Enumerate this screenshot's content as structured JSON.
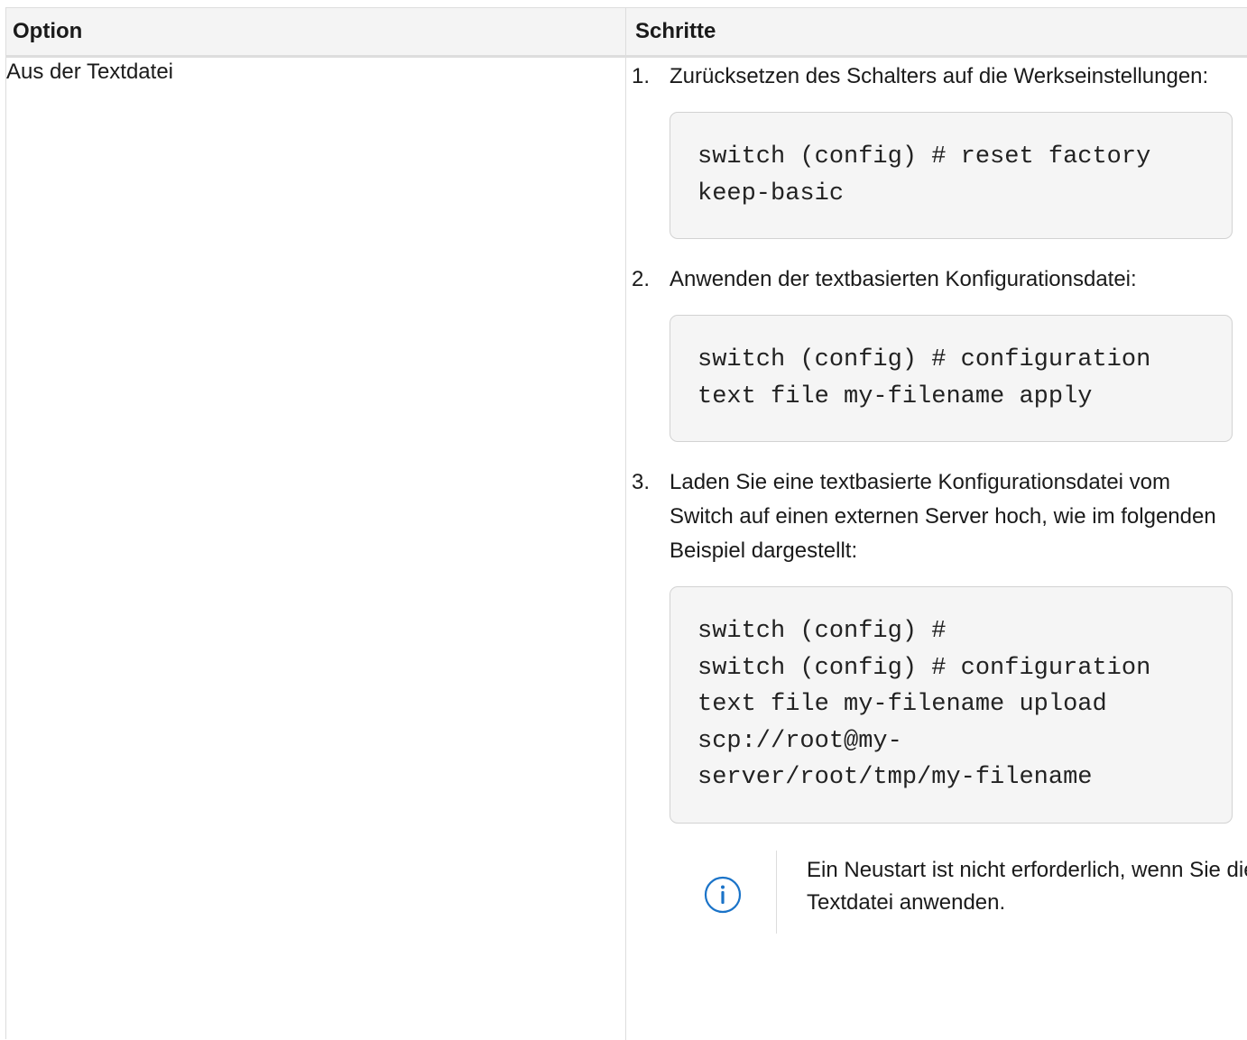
{
  "table": {
    "headers": {
      "option": "Option",
      "steps": "Schritte"
    },
    "row": {
      "option": "Aus der Textdatei",
      "steps": [
        {
          "number": "1.",
          "text": "Zurücksetzen des Schalters auf die Werkseinstellungen:",
          "code": "switch (config) # reset factory\nkeep-basic"
        },
        {
          "number": "2.",
          "text": "Anwenden der textbasierten Konfigurationsdatei:",
          "code": "switch (config) # configuration\ntext file my-filename apply"
        },
        {
          "number": "3.",
          "text": "Laden Sie eine textbasierte Konfigurationsdatei vom Switch auf einen externen Server hoch, wie im folgenden Beispiel dargestellt:",
          "code": "switch (config) #\nswitch (config) # configuration\ntext file my-filename upload\nscp://root@my-\nserver/root/tmp/my-filename"
        }
      ],
      "note": {
        "icon": "info-icon",
        "text": "Ein Neustart ist nicht erforderlich, wenn Sie die Textdatei anwenden."
      }
    }
  },
  "colors": {
    "border": "#dddddd",
    "header_background": "#f4f4f4",
    "code_background": "#f5f5f5",
    "info_icon": "#1a73c8"
  }
}
